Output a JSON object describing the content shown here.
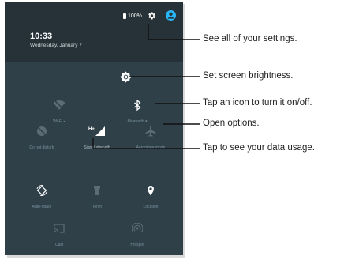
{
  "status": {
    "battery": "100%"
  },
  "header": {
    "time": "10:33",
    "date": "Wednesday, January 7"
  },
  "tiles": {
    "wifi": {
      "label": "Wi-Fi"
    },
    "bluetooth": {
      "label": "Bluetooth"
    },
    "dnd": {
      "label": "Do not disturb"
    },
    "signal": {
      "label": "Signal strength",
      "badge": "H+"
    },
    "airplane": {
      "label": "Aeroplane mode"
    },
    "autorotate": {
      "label": "Auto-rotate"
    },
    "torch": {
      "label": "Torch"
    },
    "location": {
      "label": "Location"
    },
    "cast": {
      "label": "Cast"
    },
    "hotspot": {
      "label": "Hotspot"
    }
  },
  "callouts": {
    "settings": "See all of your settings.",
    "brightness": "Set screen brightness.",
    "toggle": "Tap an icon to turn it on/off.",
    "options": "Open options.",
    "data": "Tap to see your data usage."
  },
  "colors": {
    "panel": "#2f4049",
    "header": "#263238",
    "accent": "#29b6f6"
  }
}
